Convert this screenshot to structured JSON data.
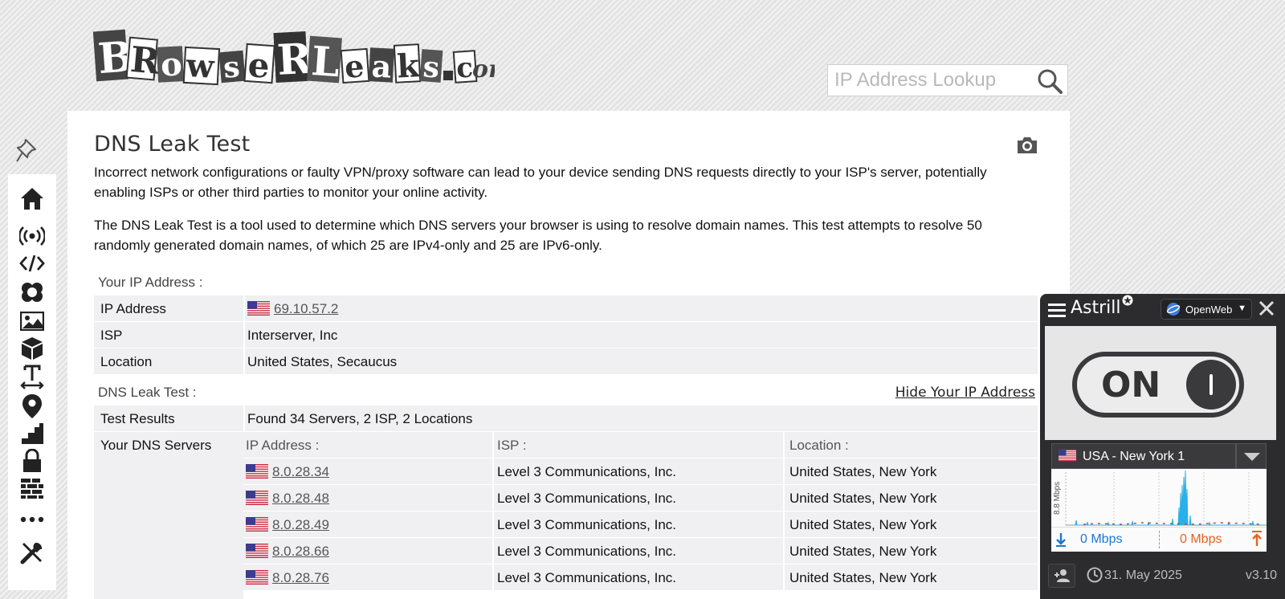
{
  "site": {
    "logo_text": "BrowserLeaks.com"
  },
  "search": {
    "placeholder": "IP Address Lookup"
  },
  "sidebar": {
    "items": [
      "home-icon",
      "wireless-icon",
      "code-icon",
      "webrtc-icon",
      "image-icon",
      "box-3d-icon",
      "text-width-icon",
      "location-pin-icon",
      "stairs-icon",
      "lock-icon",
      "firewall-icon",
      "more-icon",
      "tools-icon"
    ]
  },
  "page": {
    "title": "DNS Leak Test",
    "intro1": "Incorrect network configurations or faulty VPN/proxy software can lead to your device sending DNS requests directly to your ISP's server, potentially enabling ISPs or other third parties to monitor your online activity.",
    "intro2": "The DNS Leak Test is a tool used to determine which DNS servers your browser is using to resolve domain names. This test attempts to resolve 50 randomly generated domain names, of which 25 are IPv4-only and 25 are IPv6-only."
  },
  "ip_section": {
    "label": "Your IP Address :",
    "rows": [
      {
        "label": "IP Address",
        "value": "69.10.57.2"
      },
      {
        "label": "ISP",
        "value": "Interserver, Inc"
      },
      {
        "label": "Location",
        "value": "United States, Secaucus"
      }
    ]
  },
  "dns_section": {
    "label": "DNS Leak Test :",
    "hide_link": "Hide Your IP Address",
    "results_label": "Test Results",
    "results_value": "Found 34 Servers, 2 ISP, 2 Locations",
    "servers_label": "Your DNS Servers",
    "columns": [
      "IP Address :",
      "ISP :",
      "Location :"
    ],
    "servers": [
      {
        "ip": "8.0.28.34",
        "isp": "Level 3 Communications, Inc.",
        "location": "United States, New York"
      },
      {
        "ip": "8.0.28.48",
        "isp": "Level 3 Communications, Inc.",
        "location": "United States, New York"
      },
      {
        "ip": "8.0.28.49",
        "isp": "Level 3 Communications, Inc.",
        "location": "United States, New York"
      },
      {
        "ip": "8.0.28.66",
        "isp": "Level 3 Communications, Inc.",
        "location": "United States, New York"
      },
      {
        "ip": "8.0.28.76",
        "isp": "Level 3 Communications, Inc.",
        "location": "United States, New York"
      }
    ]
  },
  "astrill": {
    "brand": "Astrill",
    "mode": "OpenWeb",
    "toggle_label": "ON",
    "server": "USA - New York 1",
    "graph_label": "8.8 Mbps",
    "download": "0 Mbps",
    "upload": "0 Mbps",
    "date": "31. May 2025",
    "version": "v3.10"
  },
  "colors": {
    "download": "#1b75d8",
    "upload": "#e8621e",
    "graph": "#2ab0e8"
  }
}
